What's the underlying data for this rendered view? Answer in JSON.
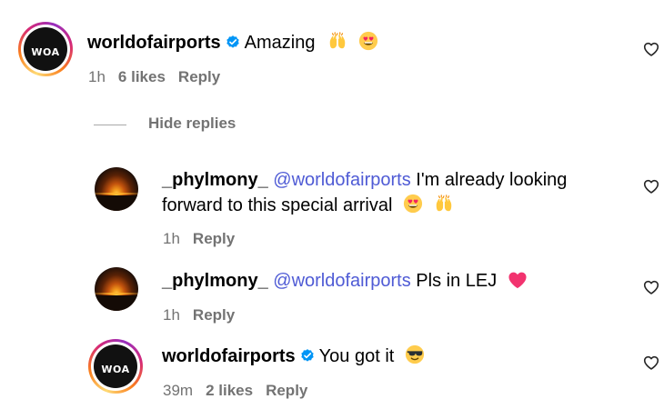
{
  "comments": [
    {
      "username": "worldofairports",
      "verified": true,
      "avatar": "worldofairports-logo",
      "avatar_text": "WOA",
      "mention": "",
      "text": "Amazing",
      "emojis": [
        "raising-hands",
        "heart-eyes"
      ],
      "time": "1h",
      "likes": "6 likes",
      "reply": "Reply"
    },
    {
      "username": "_phylmony_",
      "verified": false,
      "avatar": "sunset-photo",
      "mention": "@worldofairports",
      "text_line1": "I'm already looking",
      "text_line2": "forward to this special arrival",
      "emojis": [
        "heart-eyes",
        "raising-hands"
      ],
      "time": "1h",
      "reply": "Reply"
    },
    {
      "username": "_phylmony_",
      "verified": false,
      "avatar": "sunset-photo",
      "mention": "@worldofairports",
      "text": "Pls in LEJ",
      "emojis": [
        "pink-heart"
      ],
      "time": "1h",
      "reply": "Reply"
    },
    {
      "username": "worldofairports",
      "verified": true,
      "avatar": "worldofairports-logo",
      "avatar_text": "WOA",
      "text": "You got it",
      "emojis": [
        "sunglasses-face"
      ],
      "time": "39m",
      "likes": "2 likes",
      "reply": "Reply"
    }
  ],
  "hide_replies_label": "Hide replies",
  "icons": {
    "like": "heart-outline-icon",
    "verified": "verified-badge-icon"
  },
  "colors": {
    "verified_blue": "#0095f6",
    "mention": "#4f5bd5",
    "meta_gray": "#737373"
  }
}
